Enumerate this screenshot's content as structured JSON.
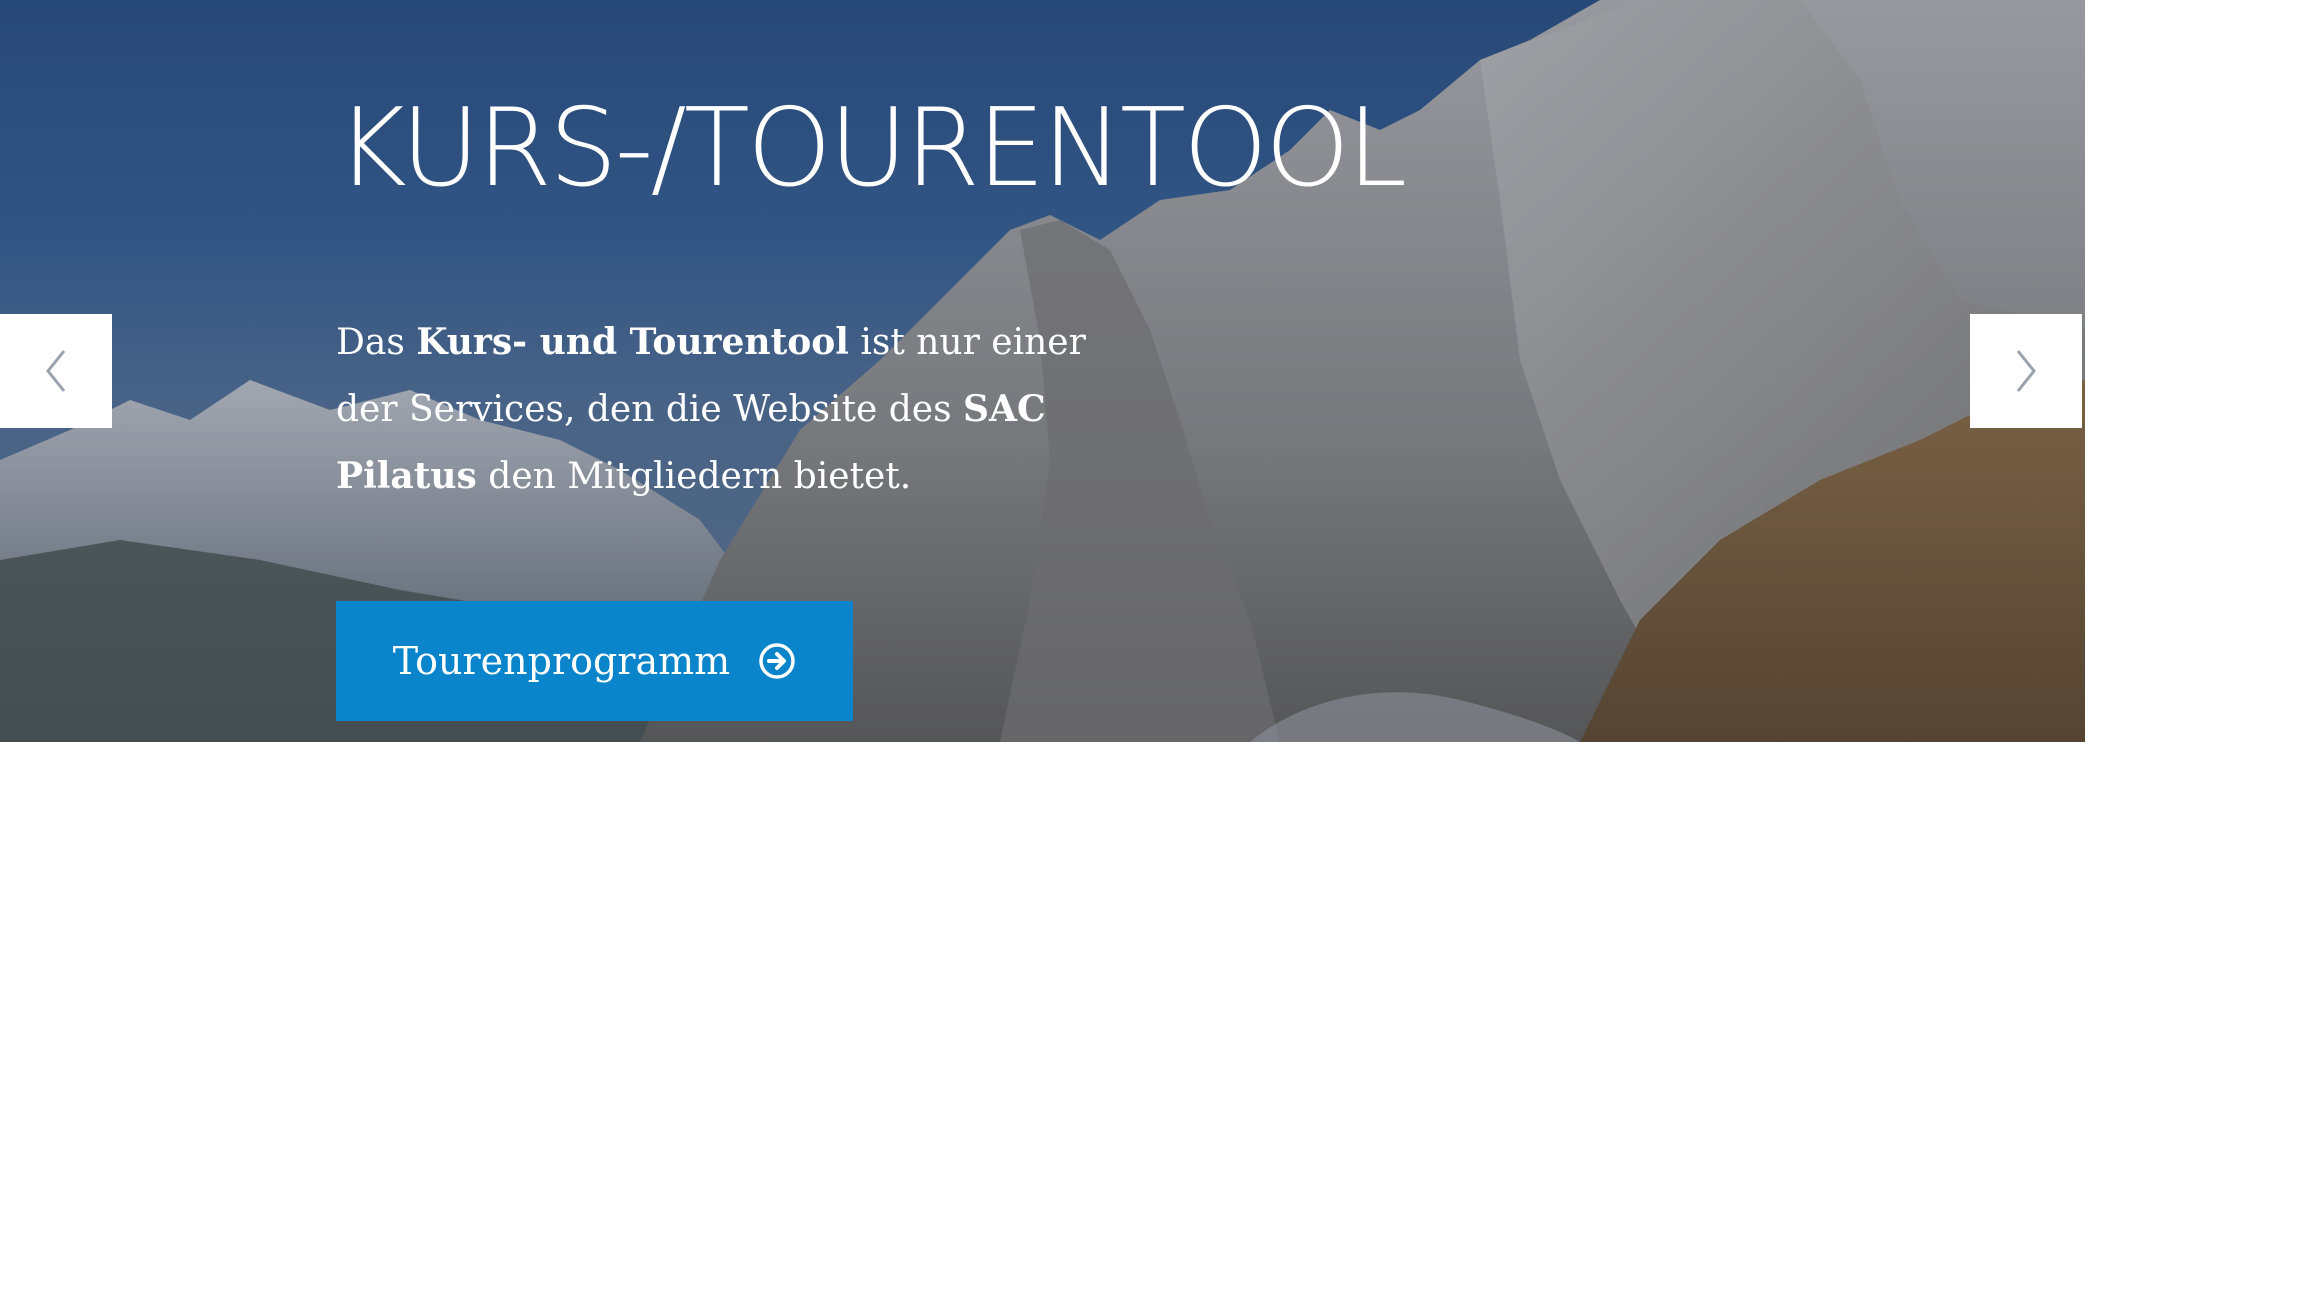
{
  "hero": {
    "title": "KURS-/TOURENTOOL",
    "text_parts": {
      "p1": "Das ",
      "b1": "Kurs- und Tourentool",
      "p2": " ist nur einer der Services, den die Website des ",
      "b2": "SAC Pilatus",
      "p3": " den Mitgliedern bietet."
    },
    "button_label": "Tourenprogramm",
    "button_icon": "arrow-circle-right-icon",
    "background_image": "mountain-landscape"
  },
  "carousel": {
    "prev_icon": "chevron-left-icon",
    "next_icon": "chevron-right-icon"
  },
  "colors": {
    "accent": "#0a85cc",
    "text": "#ffffff",
    "arrow": "#9aa3ad"
  }
}
